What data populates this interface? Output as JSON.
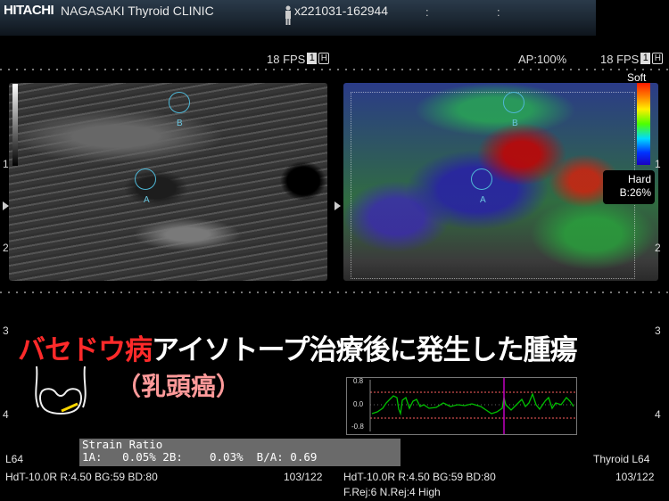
{
  "header": {
    "maker": "HITACHI",
    "clinic": "NAGASAKI Thyroid CLINIC",
    "patient_id": "x221031-162944",
    "colons": [
      ":",
      ":"
    ]
  },
  "left_panel": {
    "fps": "18 FPS",
    "badge_1": "1",
    "badge_h": "H"
  },
  "right_panel": {
    "ap": "AP:100%",
    "fps": "18 FPS",
    "badge_1": "1",
    "badge_h": "H",
    "soft_label": "Soft",
    "hard_label": "Hard",
    "b_ratio": "B:26%"
  },
  "depth_scale": {
    "left": [
      "1",
      "2",
      "3",
      "4"
    ],
    "right": [
      "1",
      "2",
      "3",
      "4"
    ]
  },
  "roi_labels": {
    "a": "A",
    "b": "B"
  },
  "title": {
    "red_part": "バセドウ病",
    "white_part": "アイソトープ治療後に発生した腫瘍",
    "subtitle": "（乳頭癌）"
  },
  "strain": {
    "heading": "Strain Ratio",
    "values": "1A:   0.05% 2B:    0.03%  B/A: 0.69"
  },
  "graph": {
    "y_labels": [
      "0.8",
      "0.0",
      "-0.8"
    ]
  },
  "footer": {
    "left_probe": "L64",
    "left_params": "HdT-10.0R   R:4.50  BG:59  BD:80",
    "left_frames": "103/122",
    "right_params": "HdT-10.0R   R:4.50  BG:59  BD:80",
    "right_probe": "Thyroid L64",
    "right_frames": "103/122",
    "rejection": "F.Rej:6 N.Rej:4  High"
  },
  "colors": {
    "title_red": "#ff2a2a",
    "subtitle_pink": "#ff9a9a",
    "roi_circle": "#4fb7d6",
    "graph_line": "#00c000",
    "graph_cursor": "#c000c0",
    "graph_threshold": "#ff6060"
  }
}
